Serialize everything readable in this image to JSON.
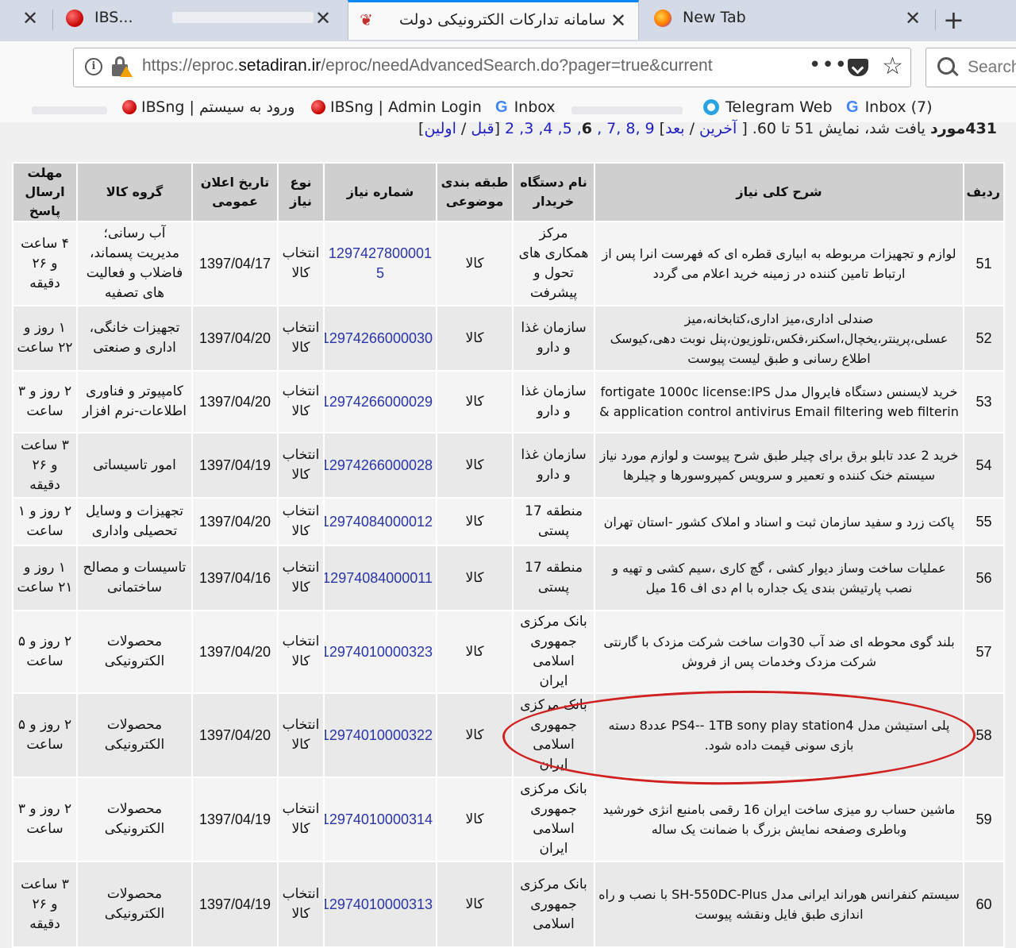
{
  "tabs": [
    {
      "title": "",
      "active": false
    },
    {
      "title": "IBS...",
      "active": false
    },
    {
      "title": "سامانه تدارکات الکترونیکی دولت",
      "active": true
    },
    {
      "title": "New Tab",
      "active": false
    }
  ],
  "url": {
    "prefix": "https://eproc.",
    "domain": "setadiran.ir",
    "path": "/eproc/needAdvancedSearch.do?pager=true&current"
  },
  "search": {
    "placeholder": "Search"
  },
  "bookmarks": [
    "IBSng | ورود به سیستم",
    "IBSng | Admin Login",
    "Inbox",
    "Telegram Web",
    "Inbox (7)"
  ],
  "pager": {
    "count": "431مورد",
    "found_text": "یافت شد، نمایش 51 تا 60. [",
    "last": "آخرین",
    "next": "بعد",
    "pages_before": "9 ,8 ,7 ,",
    "current": "6",
    "pages_after": ", 5, 4, 3, 2",
    "prev": "قبل",
    "first": "اولین"
  },
  "headers": {
    "row": "ردیف",
    "desc": "شرح کلی نیاز",
    "buyer": "نام دستگاه خریدار",
    "class": "طبقه بندی موضوعی",
    "number": "شماره نیاز",
    "type": "نوع نیاز",
    "date": "تاریخ اعلان عمومی",
    "group": "گروه کالا",
    "deadline": "مهلت ارسال پاسخ"
  },
  "rows": [
    {
      "idx": "51",
      "desc": "لوازم و تجهیزات مربوطه به ابیاری قطره ای که فهرست انرا پس از ارتباط تامین کننده در زمینه خرید اعلام می گردد",
      "buyer": "مرکز همکاری های تحول و پیشرفت",
      "class": "کالا",
      "number": "1297427800001 5",
      "type": "انتخاب کالا",
      "date": "1397/04/17",
      "group": "آب رسانی؛ مدیریت پسماند، فاضلاب و فعالیت های تصفیه",
      "deadline": "۴ ساعت و ۲۶ دقیقه"
    },
    {
      "idx": "52",
      "desc": "صندلی اداری،میز اداری،کتابخانه،میز عسلی،پرینتر،یخچال،اسکنر،فکس،تلوزیون،پنل نوبت دهی،کیوسک اطلاع رسانی و طبق لیست پیوست",
      "buyer": "سازمان غذا و دارو",
      "class": "کالا",
      "number": "12974266000030",
      "type": "انتخاب کالا",
      "date": "1397/04/20",
      "group": "تجهیزات خانگی، اداری و صنعتی",
      "deadline": "۱ روز و ۲۲ ساعت"
    },
    {
      "idx": "53",
      "desc": "خرید لایسنس دستگاه فایروال مدل fortigate 1000c license:IPS & application control antivirus Email filtering web filterin",
      "buyer": "سازمان غذا و دارو",
      "class": "کالا",
      "number": "12974266000029",
      "type": "انتخاب کالا",
      "date": "1397/04/20",
      "group": "کامپیوتر و فناوری اطلاعات-نرم افزار",
      "deadline": "۲ روز و ۳ ساعت"
    },
    {
      "idx": "54",
      "desc": "خرید 2 عدد تابلو برق برای چیلر طبق شرح پیوست و لوازم مورد نیاز سیستم خنک کننده و تعمیر و سرویس کمپروسورها و چیلرها",
      "buyer": "سازمان غذا و دارو",
      "class": "کالا",
      "number": "12974266000028",
      "type": "انتخاب کالا",
      "date": "1397/04/19",
      "group": "امور تاسیساتی",
      "deadline": "۳ ساعت و ۲۶ دقیقه"
    },
    {
      "idx": "55",
      "desc": "پاکت زرد و سفید سازمان ثبت و اسناد و املاک کشور -استان تهران",
      "buyer": "منطقه 17 پستی",
      "class": "کالا",
      "number": "12974084000012",
      "type": "انتخاب کالا",
      "date": "1397/04/20",
      "group": "تجهیزات و وسایل تحصیلی واداری",
      "deadline": "۲ روز و ۱ ساعت"
    },
    {
      "idx": "56",
      "desc": "عملیات ساخت وساز دیوار کشی ، گچ کاری ،سیم کشی و تهیه و نصب پارتیشن بندی یک جداره با ام دی اف 16 میل",
      "buyer": "منطقه 17 پستی",
      "class": "کالا",
      "number": "12974084000011",
      "type": "انتخاب کالا",
      "date": "1397/04/16",
      "group": "تاسیسات و مصالح ساختمانی",
      "deadline": "۱ روز و ۲۱ ساعت"
    },
    {
      "idx": "57",
      "desc": "بلند گوی محوطه ای ضد آب 30وات ساخت شرکت مزدک با گارنتی شرکت مزدک وخدمات پس از فروش",
      "buyer": "بانک مرکزی جمهوری اسلامی ایران",
      "class": "کالا",
      "number": "12974010000323",
      "type": "انتخاب کالا",
      "date": "1397/04/20",
      "group": "محصولات الکترونیکی",
      "deadline": "۲ روز و ۵ ساعت"
    },
    {
      "idx": "58",
      "desc": "پلی استیشن مدل PS4-- 1TB sony play station4 عدد8 دسته بازی سونی قیمت داده شود.",
      "buyer": "بانک مرکزی جمهوری اسلامی ایران",
      "class": "کالا",
      "number": "12974010000322",
      "type": "انتخاب کالا",
      "date": "1397/04/20",
      "group": "محصولات الکترونیکی",
      "deadline": "۲ روز و ۵ ساعت"
    },
    {
      "idx": "59",
      "desc": "ماشین حساب رو میزی ساخت ایران 16 رقمی بامنبع انژی خورشید وباطری وصفحه نمایش بزرگ با ضمانت یک ساله",
      "buyer": "بانک مرکزی جمهوری اسلامی ایران",
      "class": "کالا",
      "number": "12974010000314",
      "type": "انتخاب کالا",
      "date": "1397/04/19",
      "group": "محصولات الکترونیکی",
      "deadline": "۲ روز و ۳ ساعت"
    },
    {
      "idx": "60",
      "desc": "سیستم کنفرانس هوراند ایرانی مدل SH-550DC-Plus با نصب و راه اندازی طبق فایل ونقشه پیوست",
      "buyer": "بانک مرکزی جمهوری اسلامی",
      "class": "کالا",
      "number": "12974010000313",
      "type": "انتخاب کالا",
      "date": "1397/04/19",
      "group": "محصولات الکترونیکی",
      "deadline": "۳ ساعت و ۲۶ دقیقه"
    }
  ]
}
